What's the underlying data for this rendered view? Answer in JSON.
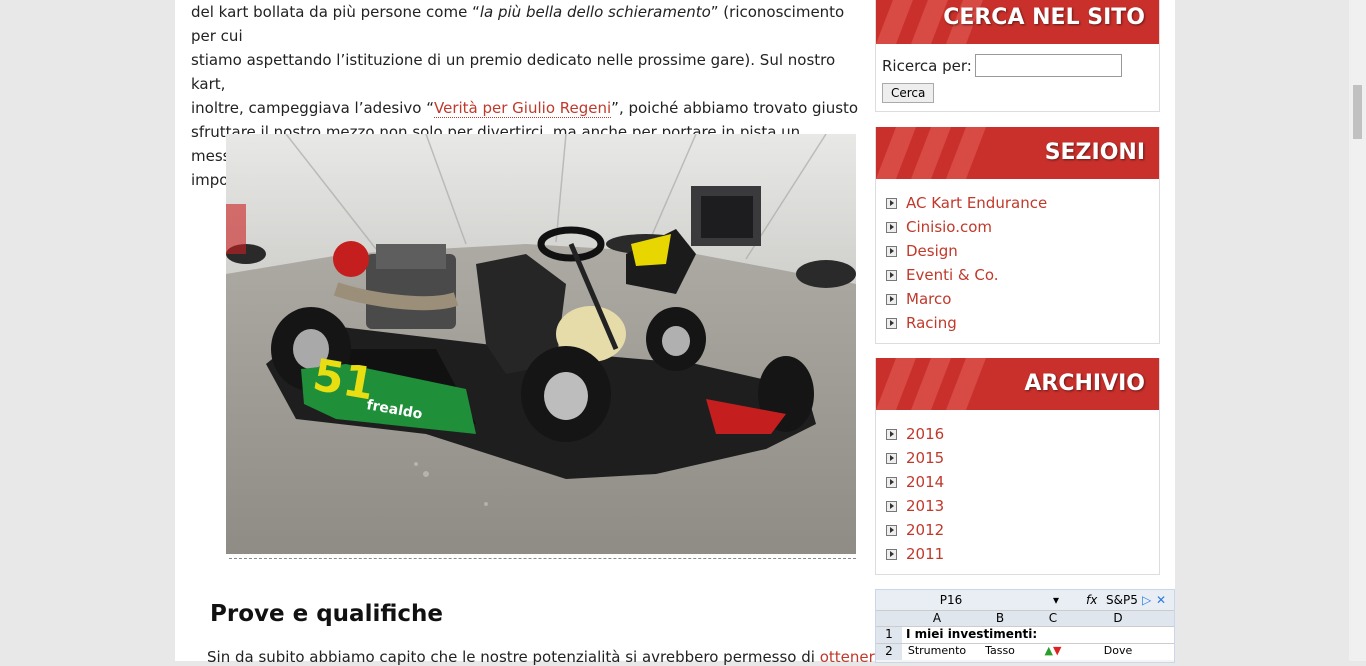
{
  "article": {
    "para1": {
      "line1_pre": "del kart bollata da più persone come “",
      "line1_em": "la più bella dello schieramento",
      "line1_post": "” (riconoscimento per cui",
      "line2": "stiamo aspettando l’istituzione di un premio dedicato nelle prossime gare). Sul nostro kart,",
      "line3_pre": "inoltre, campeggiava l’adesivo “",
      "line3_link": "Verità per Giulio Regeni",
      "line3_post": "”, poiché abbiamo trovato giusto",
      "line4": "sfruttare il nostro mezzo non solo per divertirci, ma anche per portare in pista un messaggio",
      "line5": "importante."
    },
    "heading": "Prove e qualifiche",
    "para2_start": "Sin da subito abbiamo capito che le nostre potenzialità si avrebbero permesso di ",
    "para2_link": "ottenere"
  },
  "sidebar": {
    "search": {
      "title": "CERCA NEL SITO",
      "label": "Ricerca per:",
      "value": "",
      "button": "Cerca"
    },
    "sections": {
      "title": "SEZIONI",
      "items": [
        "AC Kart Endurance",
        "Cinisio.com",
        "Design",
        "Eventi & Co.",
        "Marco",
        "Racing"
      ]
    },
    "archive": {
      "title": "ARCHIVIO",
      "items": [
        "2016",
        "2015",
        "2014",
        "2013",
        "2012",
        "2011"
      ]
    }
  },
  "ad": {
    "cell_ref": "P16",
    "fx": "fx",
    "formula": "S&P5",
    "col_a": "A",
    "col_b": "B",
    "col_c": "C",
    "col_d": "D",
    "row1_num": "1",
    "row1_text": "I miei investimenti:",
    "row2_num": "2",
    "row2_a": "Strumento",
    "row2_b": "Tasso",
    "row2_d": "Dove"
  },
  "colors": {
    "accent": "#c9302c",
    "link": "#c0392b"
  }
}
